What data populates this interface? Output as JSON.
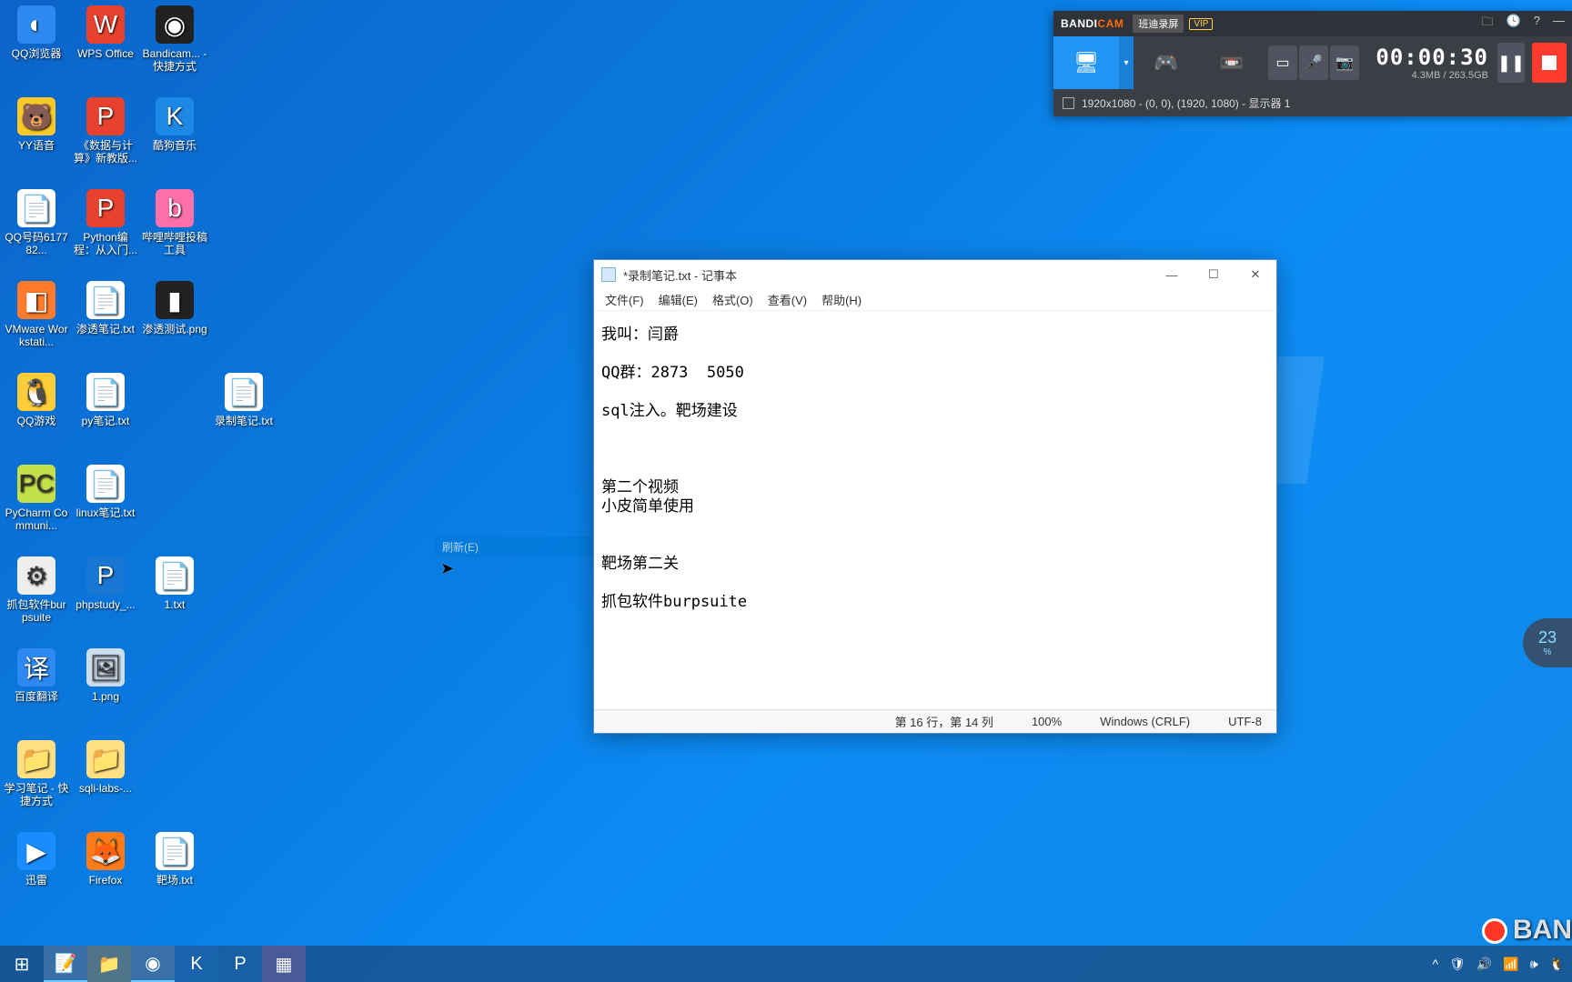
{
  "desktop_icons": [
    {
      "row": 0,
      "col": 0,
      "label": "QQ浏览器",
      "bg": "#2d89ef",
      "glyph": "◐"
    },
    {
      "row": 0,
      "col": 1,
      "label": "WPS Office",
      "bg": "#e8422e",
      "glyph": "W"
    },
    {
      "row": 0,
      "col": 2,
      "label": "Bandicam... - 快捷方式",
      "bg": "#222",
      "glyph": "◉"
    },
    {
      "row": 1,
      "col": 0,
      "label": "YY语音",
      "bg": "#ffca28",
      "glyph": "🐻"
    },
    {
      "row": 1,
      "col": 1,
      "label": "《数据与计算》新教版...",
      "bg": "#e8422e",
      "glyph": "P"
    },
    {
      "row": 1,
      "col": 2,
      "label": "酷狗音乐",
      "bg": "#1e88e5",
      "glyph": "K"
    },
    {
      "row": 2,
      "col": 0,
      "label": "QQ号码617782...",
      "bg": "#fff",
      "glyph": "📄"
    },
    {
      "row": 2,
      "col": 1,
      "label": "Python编程：从入门...",
      "bg": "#e8422e",
      "glyph": "P"
    },
    {
      "row": 2,
      "col": 2,
      "label": "哔哩哔哩投稿工具",
      "bg": "#fb6faa",
      "glyph": "b"
    },
    {
      "row": 3,
      "col": 0,
      "label": "VMware Workstati...",
      "bg": "#ff7b2b",
      "glyph": "◧"
    },
    {
      "row": 3,
      "col": 1,
      "label": "渗透笔记.txt",
      "bg": "#fff",
      "glyph": "📄"
    },
    {
      "row": 3,
      "col": 2,
      "label": "渗透测试.png",
      "bg": "#222",
      "glyph": "▮"
    },
    {
      "row": 4,
      "col": 0,
      "label": "QQ游戏",
      "bg": "#ffcd3a",
      "glyph": "🐧"
    },
    {
      "row": 4,
      "col": 1,
      "label": "py笔记.txt",
      "bg": "#fff",
      "glyph": "📄"
    },
    {
      "row": 4,
      "col": 3,
      "label": "录制笔记.txt",
      "bg": "#fff",
      "glyph": "📄"
    },
    {
      "row": 5,
      "col": 0,
      "label": "PyCharm Communi...",
      "bg": "#c4e04a",
      "glyph": "PC"
    },
    {
      "row": 5,
      "col": 1,
      "label": "linux笔记.txt",
      "bg": "#fff",
      "glyph": "📄"
    },
    {
      "row": 6,
      "col": 0,
      "label": "抓包软件burpsuite",
      "bg": "#eee",
      "glyph": "⚙"
    },
    {
      "row": 6,
      "col": 1,
      "label": "phpstudy_...",
      "bg": "#1976d2",
      "glyph": "P"
    },
    {
      "row": 6,
      "col": 2,
      "label": "1.txt",
      "bg": "#fff",
      "glyph": "📄"
    },
    {
      "row": 7,
      "col": 0,
      "label": "百度翻译",
      "bg": "#2d89ef",
      "glyph": "译"
    },
    {
      "row": 7,
      "col": 1,
      "label": "1.png",
      "bg": "#cde",
      "glyph": "🖼"
    },
    {
      "row": 8,
      "col": 0,
      "label": "学习笔记 - 快捷方式",
      "bg": "#ffe082",
      "glyph": "📁"
    },
    {
      "row": 8,
      "col": 1,
      "label": "sqli-labs-...",
      "bg": "#ffe082",
      "glyph": "📁"
    },
    {
      "row": 9,
      "col": 0,
      "label": "迅雷",
      "bg": "#1a8cff",
      "glyph": "▶"
    },
    {
      "row": 9,
      "col": 1,
      "label": "Firefox",
      "bg": "#ff7a18",
      "glyph": "🦊"
    },
    {
      "row": 9,
      "col": 2,
      "label": "靶场.txt",
      "bg": "#fff",
      "glyph": "📄"
    }
  ],
  "notepad": {
    "title": "*录制笔记.txt - 记事本",
    "menus": [
      "文件(F)",
      "编辑(E)",
      "格式(O)",
      "查看(V)",
      "帮助(H)"
    ],
    "content": "我叫：闫爵\n\nQQ群：2873  5050\n\nsql注入。靶场建设\n\n\n\n第二个视频\n小皮简单使用\n\n\n靶场第二关\n\n抓包软件burpsuite",
    "status": {
      "pos": "第 16 行，第 14 列",
      "zoom": "100%",
      "eol": "Windows (CRLF)",
      "enc": "UTF-8"
    }
  },
  "bandicam": {
    "brand_a": "BANDI",
    "brand_b": "CAM",
    "mode": "班迪录屏",
    "vip": "VIP",
    "time": "00:00:30",
    "size": "4.3MB / 263.5GB",
    "info": "1920x1080 - (0, 0), (1920, 1080) - 显示器 1"
  },
  "ctx_remnant": "刷新(E)",
  "speed": "23",
  "speed_unit": "%",
  "taskbar_apps": [
    {
      "glyph": "⊞",
      "bg": ""
    },
    {
      "glyph": "📝",
      "bg": "",
      "active": true
    },
    {
      "glyph": "📁",
      "bg": "#ffca5a"
    },
    {
      "glyph": "◉",
      "bg": "#222",
      "active": true
    },
    {
      "glyph": "K",
      "bg": "#1e88e5"
    },
    {
      "glyph": "P",
      "bg": "#1976d2"
    },
    {
      "glyph": "▦",
      "bg": "#e85a9c"
    }
  ],
  "tray": [
    "^",
    "🛡",
    "🔊",
    "📶",
    "🕪",
    "🐧"
  ],
  "watermark": "BAN"
}
